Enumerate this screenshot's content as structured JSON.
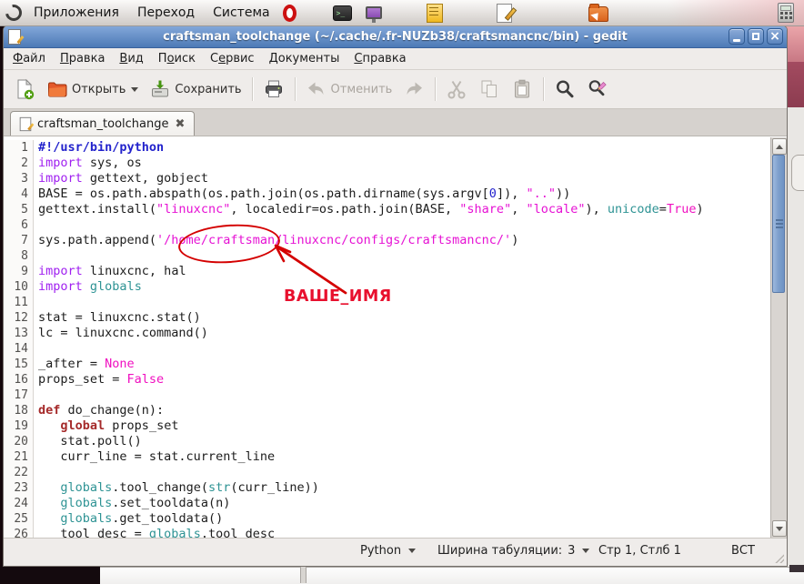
{
  "colors": {
    "titlebar-top": "#82a7d9",
    "titlebar-bottom": "#4d7ab6",
    "titlebar-text": "#ffffff",
    "annotation": "#d40000",
    "annotation-label": "#e8102e",
    "syntax-text": "#1c1c1c",
    "syntax-keyword": "#a020f0",
    "syntax-keyword2": "#a52a2a",
    "syntax-string": "#e612d4",
    "syntax-constant": "#f010c0",
    "syntax-builtin": "#2e9394",
    "syntax-number": "#2222cc",
    "syntax-shebang": "#2222cc",
    "linenum": "#52504e",
    "scrollbar-thumb": "#7d9fcc"
  },
  "panel": {
    "menus": [
      {
        "label": "Приложения"
      },
      {
        "label": "Переход"
      },
      {
        "label": "Система"
      }
    ],
    "launcher_icons": [
      "opera-icon",
      "terminal-icon",
      "display-icon",
      "notes-icon",
      "text-editor-icon",
      "archive-extract-icon",
      "calculator-icon"
    ]
  },
  "window": {
    "title": "craftsman_toolchange (~/.cache/.fr-NUZb38/craftsmancnc/bin) - gedit",
    "menubar": [
      {
        "pre": "",
        "key": "Ф",
        "post": "айл"
      },
      {
        "pre": "",
        "key": "П",
        "post": "равка"
      },
      {
        "pre": "",
        "key": "В",
        "post": "ид"
      },
      {
        "pre": "П",
        "key": "о",
        "post": "иск"
      },
      {
        "pre": "С",
        "key": "е",
        "post": "рвис"
      },
      {
        "pre": "",
        "key": "Д",
        "post": "окументы"
      },
      {
        "pre": "",
        "key": "С",
        "post": "правка"
      }
    ],
    "toolbar": {
      "open_label": "Открыть",
      "save_label": "Сохранить",
      "undo_label": "Отменить"
    },
    "tab": {
      "title": "craftsman_toolchange",
      "close_glyph": "✖"
    },
    "statusbar": {
      "language": "Python",
      "tab_width_label": "Ширина табуляции:",
      "tab_width_value": "3",
      "cursor_position": "Стр 1, Стлб 1",
      "insert_mode": "ВСТ"
    }
  },
  "annotation": {
    "label": "ВАШЕ_ИМЯ"
  },
  "code": {
    "lines": [
      {
        "n": "1",
        "segs": [
          [
            "#!/usr/bin/python",
            "sh"
          ]
        ]
      },
      {
        "n": "2",
        "segs": [
          [
            "import",
            "k"
          ],
          [
            " sys, os",
            "t"
          ]
        ]
      },
      {
        "n": "3",
        "segs": [
          [
            "import",
            "k"
          ],
          [
            " gettext, gobject",
            "t"
          ]
        ]
      },
      {
        "n": "4",
        "segs": [
          [
            "BASE = os.path.abspath(os.path.join(os.path.dirname(sys.argv[",
            "t"
          ],
          [
            "0",
            "n"
          ],
          [
            "]), ",
            "t"
          ],
          [
            "\"..\"",
            "s"
          ],
          [
            "))",
            "t"
          ]
        ]
      },
      {
        "n": "5",
        "segs": [
          [
            "gettext.install(",
            "t"
          ],
          [
            "\"linuxcnc\"",
            "s"
          ],
          [
            ", localedir=os.path.join(BASE, ",
            "t"
          ],
          [
            "\"share\"",
            "s"
          ],
          [
            ", ",
            "t"
          ],
          [
            "\"locale\"",
            "s"
          ],
          [
            "), ",
            "t"
          ],
          [
            "unicode",
            "b"
          ],
          [
            "=",
            "t"
          ],
          [
            "True",
            "v"
          ],
          [
            ")",
            "t"
          ]
        ]
      },
      {
        "n": "6",
        "segs": []
      },
      {
        "n": "7",
        "segs": [
          [
            "sys.path.append(",
            "t"
          ],
          [
            "'/home/craftsman/linuxcnc/configs/craftsmancnc/'",
            "s"
          ],
          [
            ")",
            "t"
          ]
        ]
      },
      {
        "n": "8",
        "segs": []
      },
      {
        "n": "9",
        "segs": [
          [
            "import",
            "k"
          ],
          [
            " linuxcnc, hal",
            "t"
          ]
        ]
      },
      {
        "n": "10",
        "segs": [
          [
            "import",
            "k"
          ],
          [
            " ",
            "t"
          ],
          [
            "globals",
            "b"
          ]
        ]
      },
      {
        "n": "11",
        "segs": []
      },
      {
        "n": "12",
        "segs": [
          [
            "stat = linuxcnc.stat()",
            "t"
          ]
        ]
      },
      {
        "n": "13",
        "segs": [
          [
            "lc = linuxcnc.command()",
            "t"
          ]
        ]
      },
      {
        "n": "14",
        "segs": []
      },
      {
        "n": "15",
        "segs": [
          [
            "_after = ",
            "t"
          ],
          [
            "None",
            "v"
          ]
        ]
      },
      {
        "n": "16",
        "segs": [
          [
            "props_set = ",
            "t"
          ],
          [
            "False",
            "v"
          ]
        ]
      },
      {
        "n": "17",
        "segs": []
      },
      {
        "n": "18",
        "segs": [
          [
            "def",
            "d"
          ],
          [
            " do_change(n):",
            "t"
          ]
        ]
      },
      {
        "n": "19",
        "segs": [
          [
            "   ",
            "t"
          ],
          [
            "global",
            "d"
          ],
          [
            " props_set",
            "t"
          ]
        ]
      },
      {
        "n": "20",
        "segs": [
          [
            "   stat.poll()",
            "t"
          ]
        ]
      },
      {
        "n": "21",
        "segs": [
          [
            "   curr_line = stat.current_line",
            "t"
          ]
        ]
      },
      {
        "n": "22",
        "segs": []
      },
      {
        "n": "23",
        "segs": [
          [
            "   ",
            "t"
          ],
          [
            "globals",
            "b"
          ],
          [
            ".tool_change(",
            "t"
          ],
          [
            "str",
            "b"
          ],
          [
            "(curr_line))",
            "t"
          ]
        ]
      },
      {
        "n": "24",
        "segs": [
          [
            "   ",
            "t"
          ],
          [
            "globals",
            "b"
          ],
          [
            ".set_tooldata(n)",
            "t"
          ]
        ]
      },
      {
        "n": "25",
        "segs": [
          [
            "   ",
            "t"
          ],
          [
            "globals",
            "b"
          ],
          [
            ".get_tooldata()",
            "t"
          ]
        ]
      },
      {
        "n": "26",
        "segs": [
          [
            "   tool_desc = ",
            "t"
          ],
          [
            "globals",
            "b"
          ],
          [
            ".tool_desc",
            "t"
          ]
        ]
      }
    ]
  }
}
